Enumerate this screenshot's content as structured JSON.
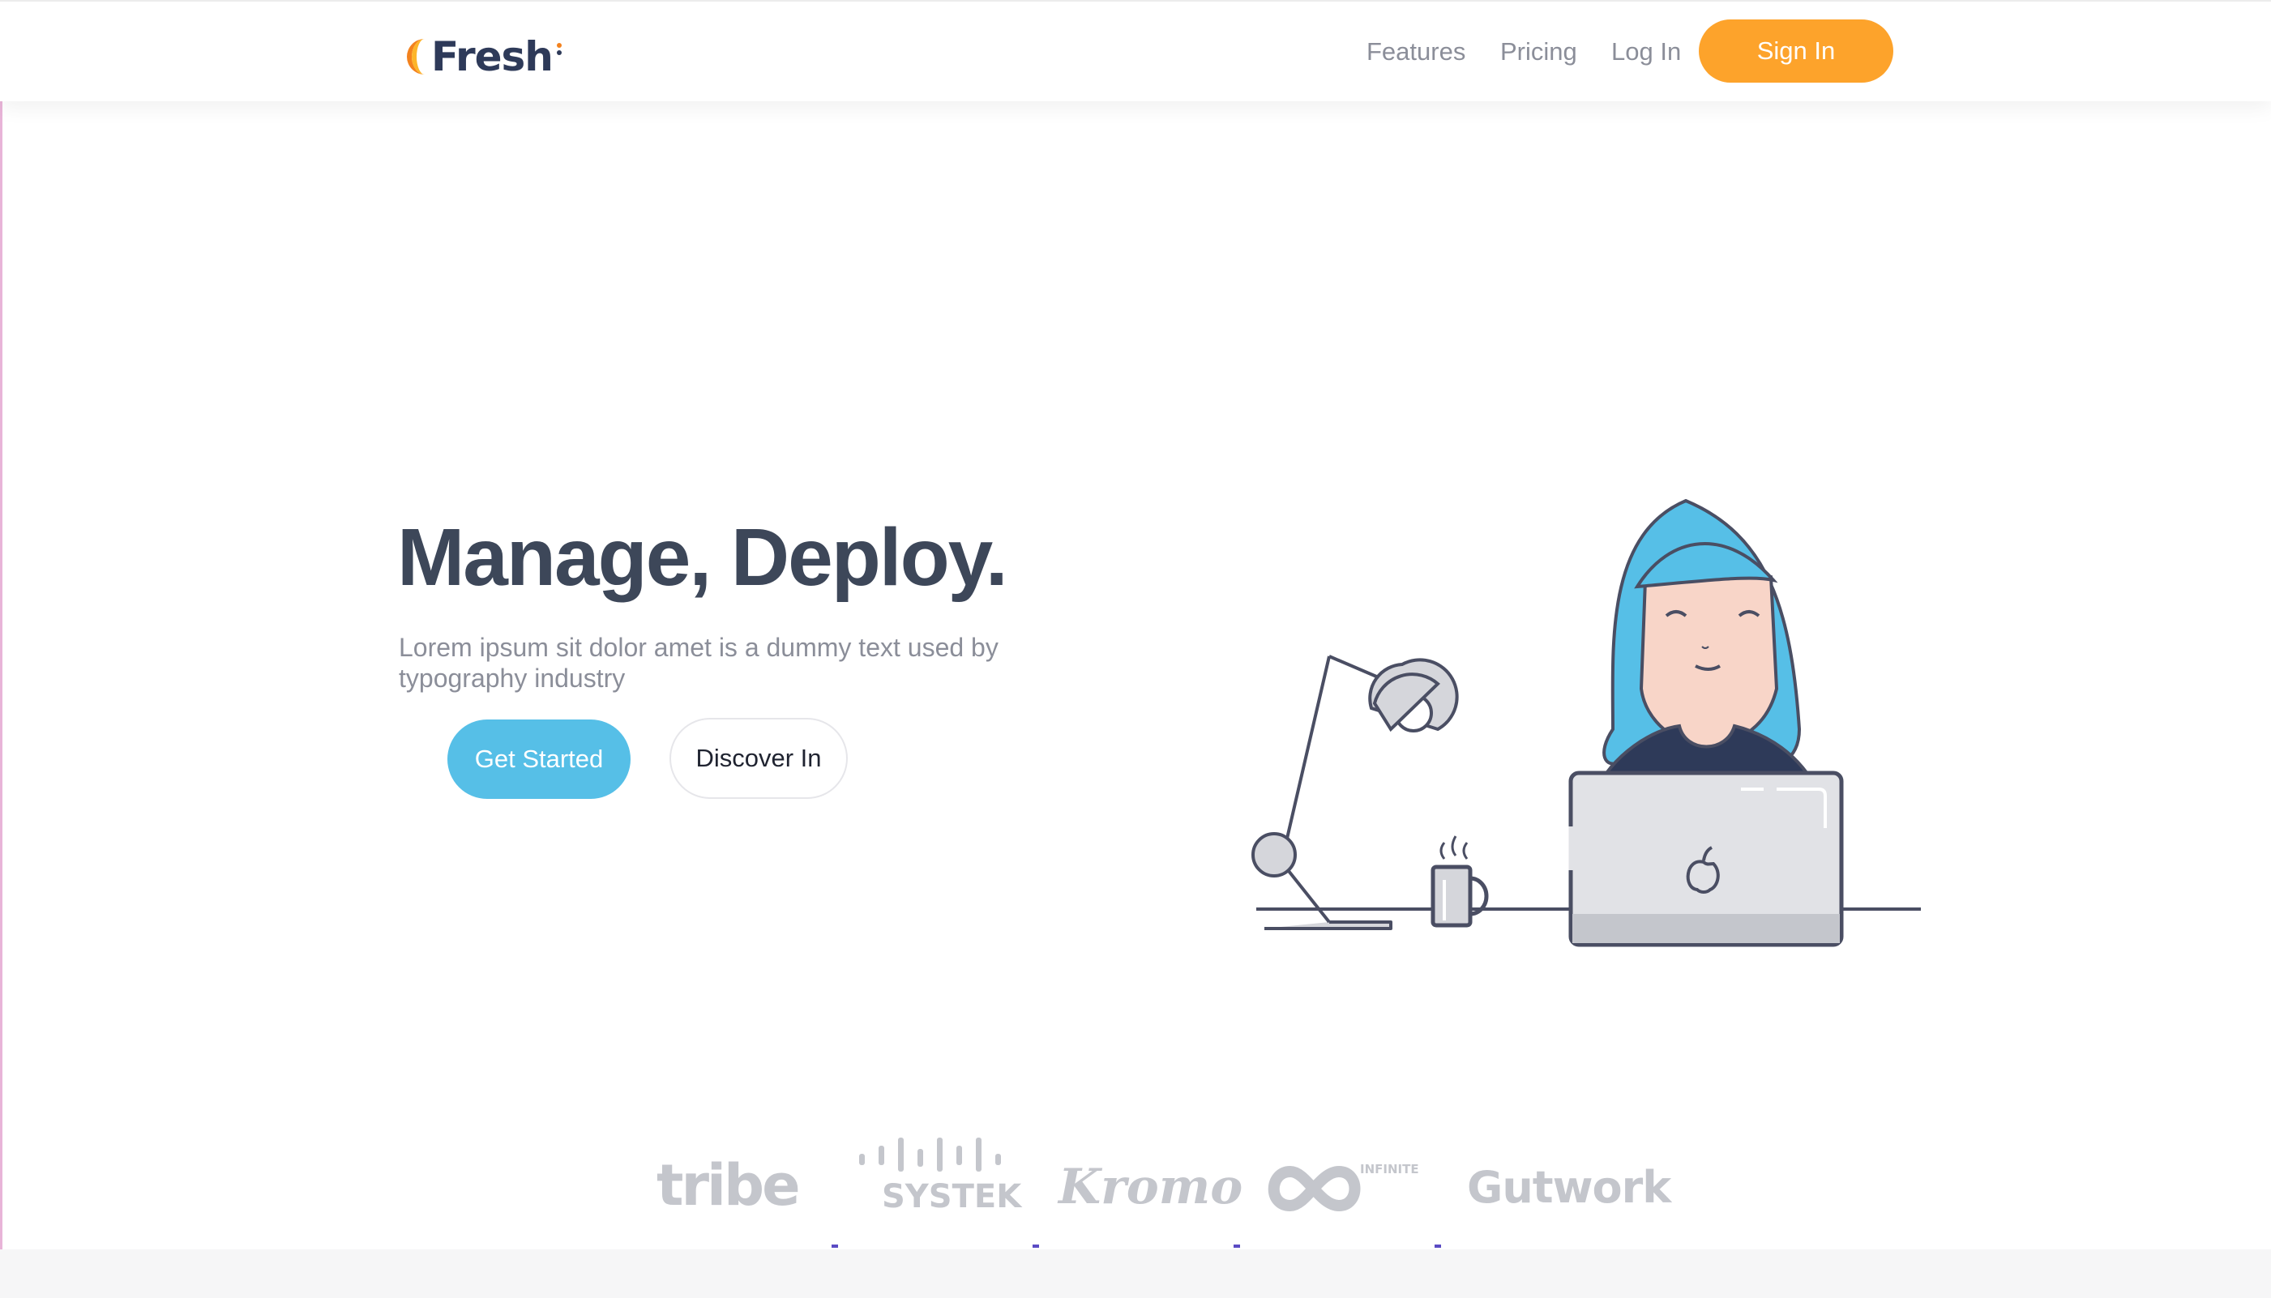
{
  "brand": {
    "name": "Fresh",
    "accent": "#fda32b",
    "primary": "#56bfe7"
  },
  "nav": {
    "features": "Features",
    "pricing": "Pricing",
    "login": "Log In",
    "signin": "Sign In"
  },
  "hero": {
    "title": "Manage, Deploy.",
    "subtitle": "Lorem ipsum sit dolor amet is a dummy text used by typography industry",
    "cta_primary": "Get Started",
    "cta_secondary": "Discover In"
  },
  "clients": [
    "tribe",
    "SYSTEK",
    "Kromo",
    "INFINITE",
    "Gutwork"
  ]
}
